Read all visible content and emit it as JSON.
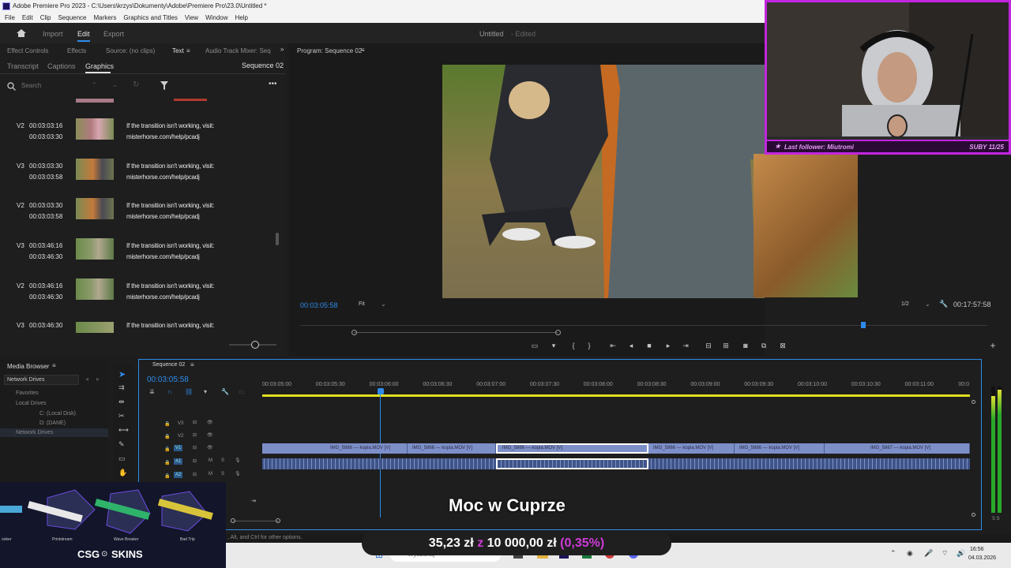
{
  "window": {
    "title": "Adobe Premiere Pro 2023 - C:\\Users\\krzys\\Dokumenty\\Adobe\\Premiere Pro\\23.0\\Untitled *",
    "menu": [
      "File",
      "Edit",
      "Clip",
      "Sequence",
      "Markers",
      "Graphics and Titles",
      "View",
      "Window",
      "Help"
    ]
  },
  "workspace": {
    "tabs": [
      "Import",
      "Edit",
      "Export"
    ],
    "active": "Edit",
    "project_title": "Untitled",
    "project_status": "- Edited"
  },
  "left_panel": {
    "tabs_row1": [
      "Effect Controls",
      "Effects",
      "Source: (no clips)",
      "Text",
      "Audio Track Mixer: Seq"
    ],
    "tabs_row2": [
      "Transcript",
      "Captions",
      "Graphics"
    ],
    "sequence_label": "Sequence 02",
    "search_placeholder": "Search",
    "items": [
      {
        "track": "V2",
        "in": "00:03:03:16",
        "out": "00:03:03:30",
        "line1": "If the transition isn't working, visit:",
        "line2": "misterhorse.com/help/pcadj"
      },
      {
        "track": "V3",
        "in": "00:03:03:30",
        "out": "00:03:03:58",
        "line1": "If the transition isn't working, visit:",
        "line2": "misterhorse.com/help/pcadj"
      },
      {
        "track": "V2",
        "in": "00:03:03:30",
        "out": "00:03:03:58",
        "line1": "If the transition isn't working, visit:",
        "line2": "misterhorse.com/help/pcadj"
      },
      {
        "track": "V3",
        "in": "00:03:46:16",
        "out": "00:03:46:30",
        "line1": "If the transition isn't working, visit:",
        "line2": "misterhorse.com/help/pcadj"
      },
      {
        "track": "V2",
        "in": "00:03:46:16",
        "out": "00:03:46:30",
        "line1": "If the transition isn't working, visit:",
        "line2": "misterhorse.com/help/pcadj"
      },
      {
        "track": "V3",
        "in": "00:03:46:30",
        "out": "",
        "line1": "If the transition isn't working, visit:",
        "line2": ""
      }
    ]
  },
  "program": {
    "label": "Program: Sequence 02",
    "timecode": "00:03:05:58",
    "fit": "Fit",
    "resolution": "1/2",
    "duration": "00:17:57:58",
    "playhead_fraction": 0.5
  },
  "media_browser": {
    "title": "Media Browser",
    "location": "Network Drives",
    "tree": [
      "Favorites",
      "Local Drives",
      "C: (Local Disk)",
      "D: (DANE)",
      "Network Drives"
    ]
  },
  "timeline": {
    "title": "Sequence 02",
    "timecode": "00:03:05:58",
    "ruler": [
      "00:03:05:00",
      "00:03:05:30",
      "00:03:06:00",
      "00:03:06:30",
      "00:03:07:00",
      "00:03:07:30",
      "00:03:08:00",
      "00:03:08:30",
      "00:03:09:00",
      "00:03:09:30",
      "00:03:10:00",
      "00:03:10:30",
      "00:03:11:00",
      "00:0"
    ],
    "tracks": [
      "V3",
      "V2",
      "V1",
      "A1",
      "A2"
    ],
    "clips": [
      "IMG_5866 — kopia.MOV [V]",
      "IMG_5866 — kopia.MOV [V]",
      "IMG_5866 — kopia.MOV [V]",
      "IMG_5866 — kopia.MOV [V]",
      "IMG_5866 — kopia.MOV [V]",
      "IMG_5867 — kopia.MOV [V]"
    ],
    "meter_label": "S S"
  },
  "status": {
    "hint": ", Alt, and Ctrl for other options."
  },
  "overlay": {
    "caption": "Moc w Cuprze",
    "ticker_a": "35,23 zł",
    "ticker_sep": "z",
    "ticker_b": "10 000,00 zł",
    "ticker_pct": "(0,35%)",
    "follower": "Last follower: Miutromi",
    "sub": "SUBY 11/25",
    "csg_brand": "CSG",
    "csg_brand2": "SKINS",
    "skins": [
      "Printstream",
      "Wave Breaker",
      "Bad Trip"
    ],
    "skin_left": "ooker"
  },
  "taskbar": {
    "search_placeholder": "Wyszukaj",
    "time": "16:56",
    "date": "04.03.2026"
  },
  "colors": {
    "accent_blue": "#2d8ceb",
    "clip_video": "#7c8fc9",
    "webcam_border": "#c226e0",
    "ticker_pink": "#cf3ad8"
  }
}
